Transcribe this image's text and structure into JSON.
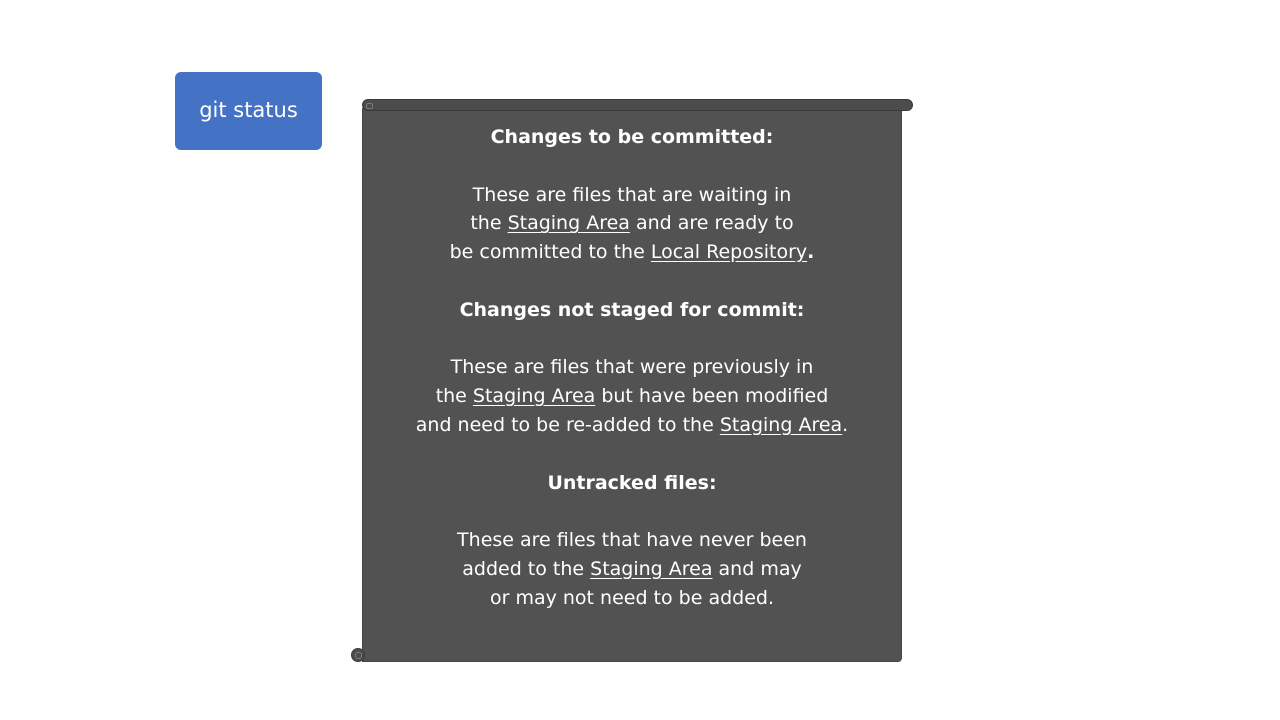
{
  "command_button": {
    "label": "git status"
  },
  "sections": [
    {
      "heading": "Changes to be committed:",
      "lines": [
        [
          "These are files that are waiting in"
        ],
        [
          "the ",
          "Staging Area",
          " and are ready to"
        ],
        [
          "be committed to the ",
          "Local Repository",
          "."
        ]
      ]
    },
    {
      "heading": "Changes not staged for commit:",
      "lines": [
        [
          "These are files that were previously in"
        ],
        [
          "the ",
          "Staging Area",
          " but have been modified"
        ],
        [
          "and need to be re-added to the ",
          "Staging Area",
          "."
        ]
      ]
    },
    {
      "heading": "Untracked files:",
      "lines": [
        [
          "These are files that have never been"
        ],
        [
          "added to the ",
          "Staging Area",
          " and may"
        ],
        [
          "or may not need to be added."
        ]
      ]
    }
  ],
  "colors": {
    "button": "#4472c4",
    "scroll": "#525252",
    "text": "#ffffff"
  }
}
